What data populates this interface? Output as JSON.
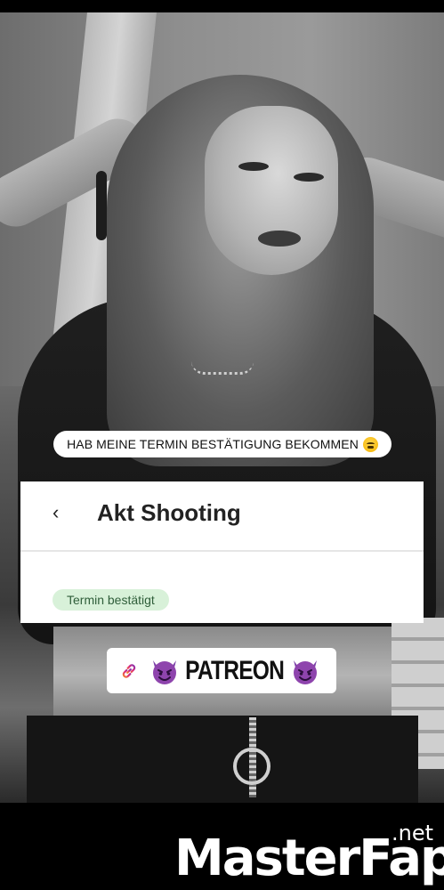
{
  "story": {
    "caption": "HAB MEINE TERMIN BESTÄTIGUNG BEKOMMEN",
    "caption_emoji": "face-with-hand-over-mouth-emoji"
  },
  "card": {
    "back_icon": "‹",
    "title": "Akt Shooting",
    "status_badge": "Termin bestätigt",
    "badge_color": "#d8f1d9"
  },
  "link_sticker": {
    "label": "PATREON",
    "left_icon": "link-icon",
    "decoration_icon": "smiling-devil-emoji",
    "icon_color": "#8e44ad"
  },
  "brand": {
    "logo": "MasterFap",
    "tld": ".net"
  }
}
